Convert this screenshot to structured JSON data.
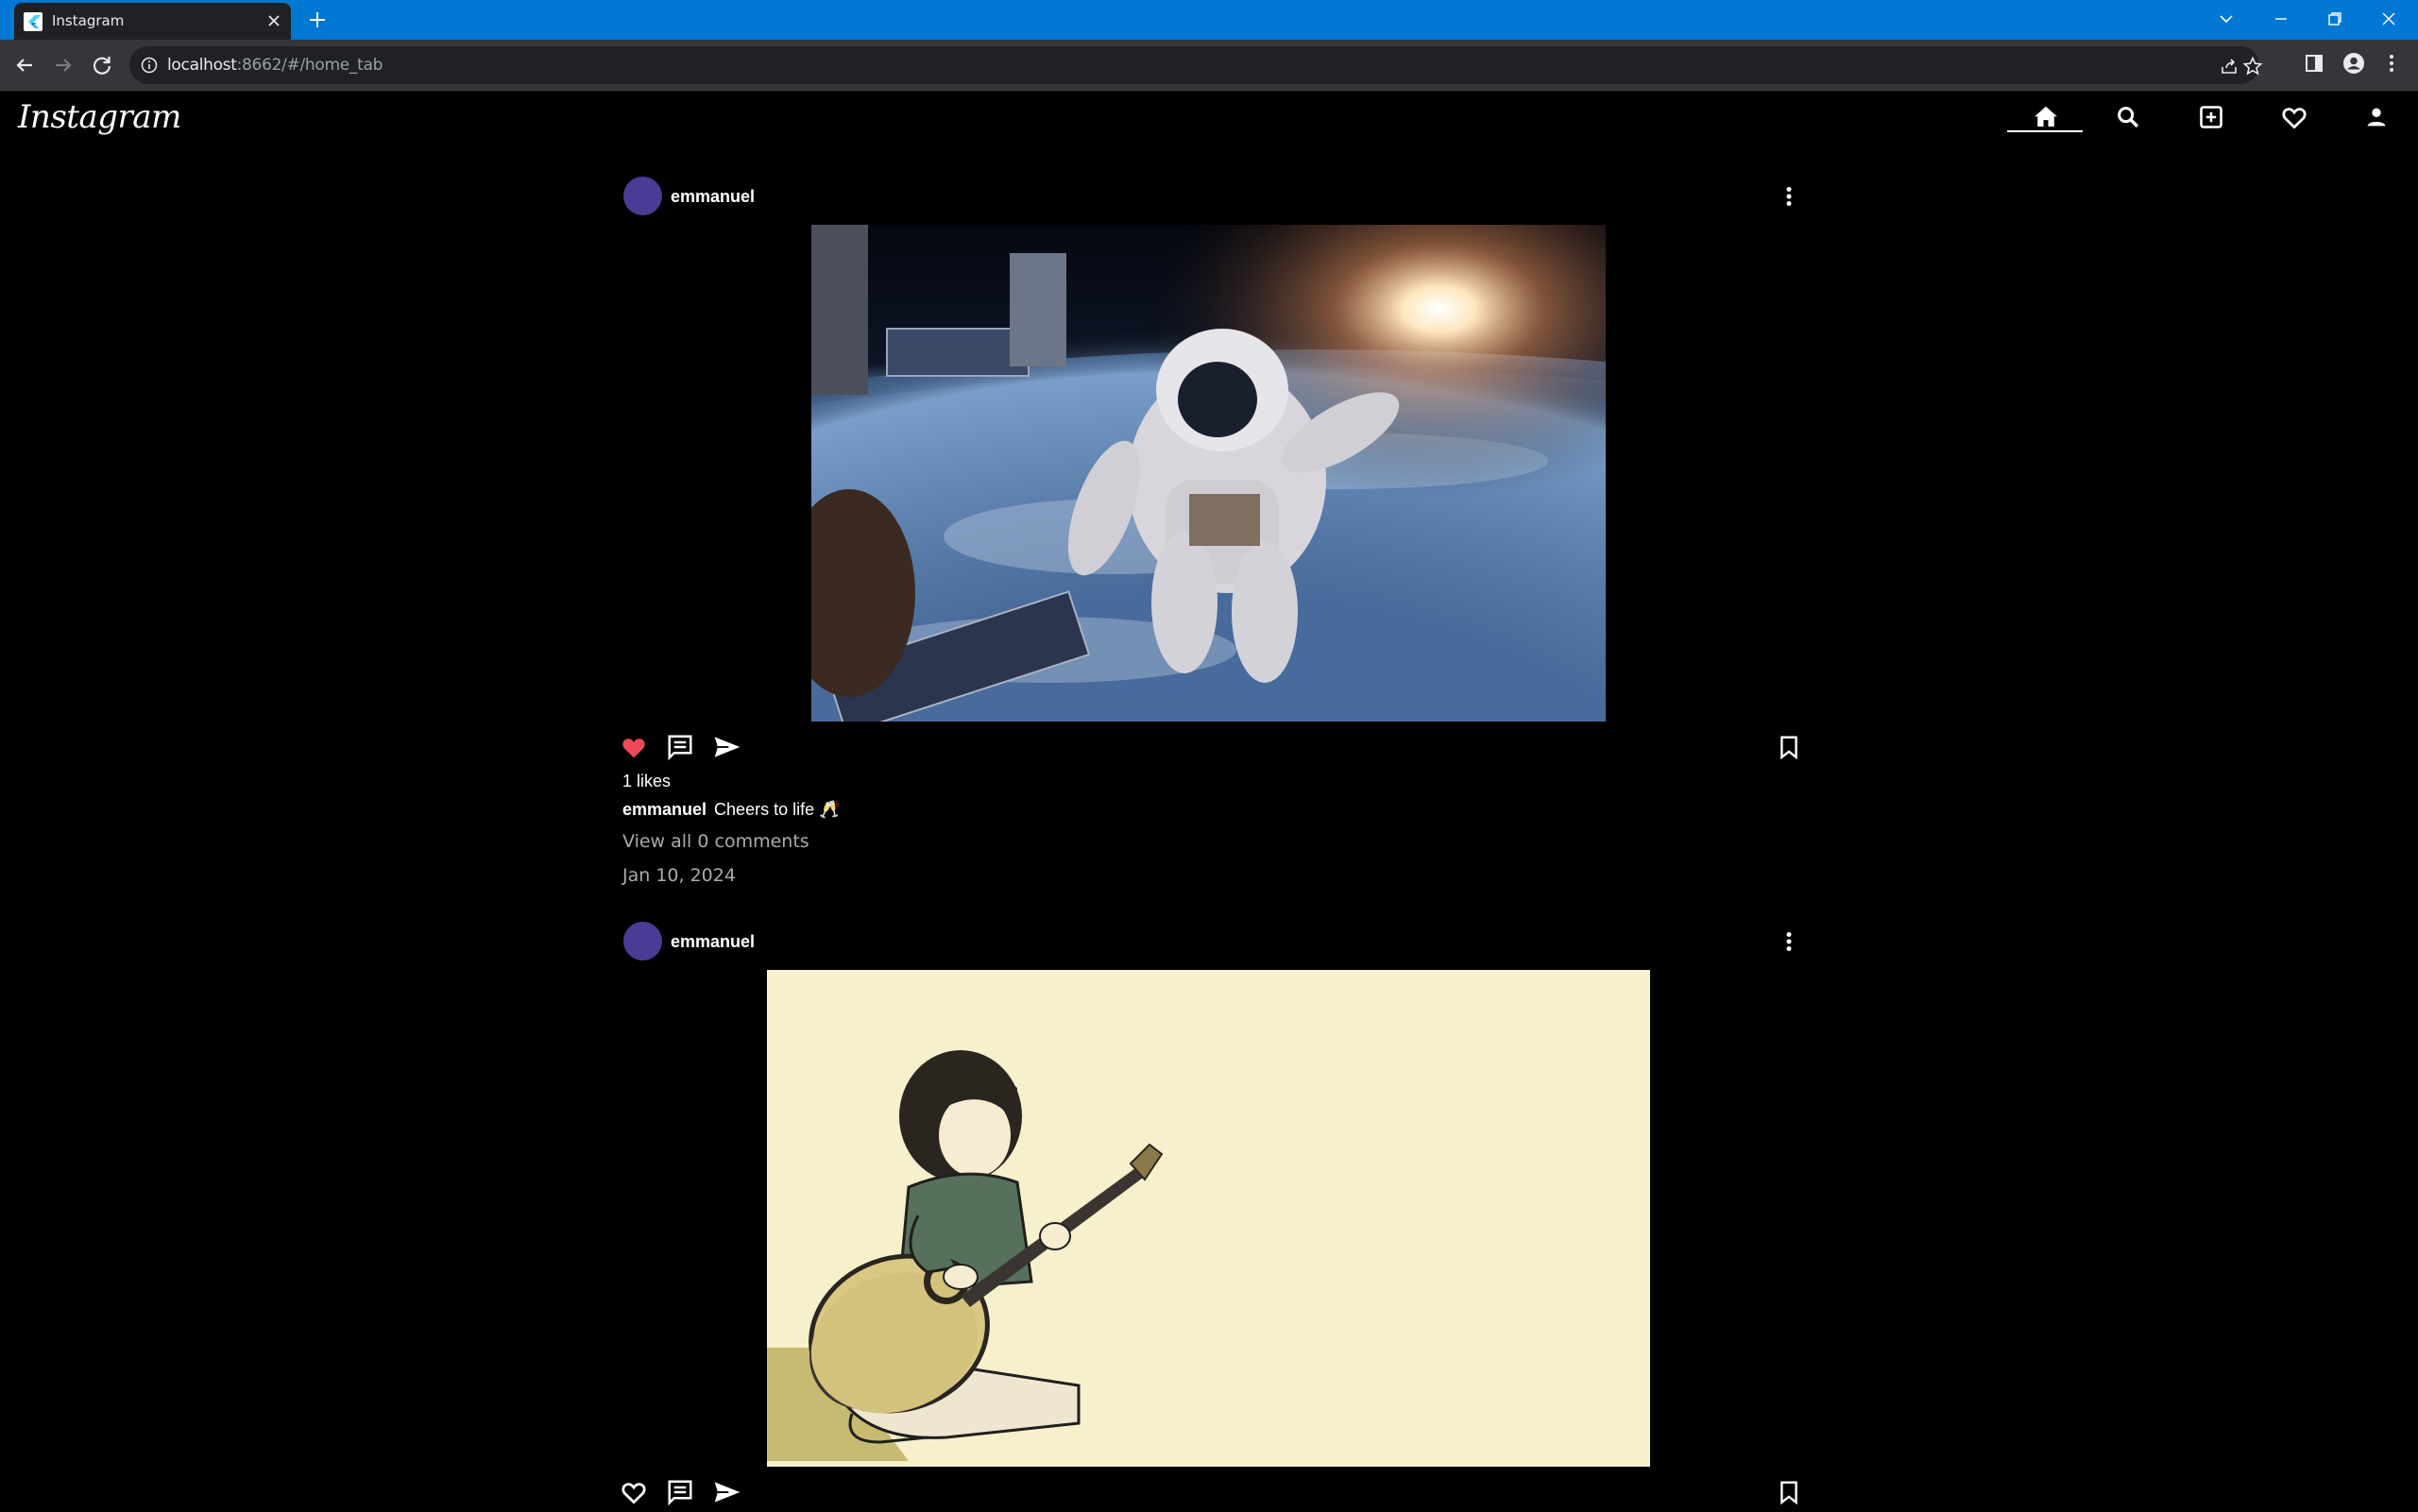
{
  "browser": {
    "tab_title": "Instagram",
    "url_host": "localhost",
    "url_path": ":8662/#/home_tab"
  },
  "app": {
    "logo": "Instagram",
    "nav": [
      "home-icon",
      "search-icon",
      "add-post-icon",
      "activity-heart-icon",
      "profile-icon"
    ],
    "active_nav": "home"
  },
  "posts": [
    {
      "username": "emmanuel",
      "image_description_icon": "astronaut-photo",
      "liked": true,
      "likes_text": "1 likes",
      "caption_user": "emmanuel",
      "caption_text": "Cheers to life 🥂",
      "view_comments": "View all 0 comments",
      "date": "Jan 10, 2024"
    },
    {
      "username": "emmanuel",
      "image_description_icon": "guitar-girl-illustration",
      "liked": false
    }
  ],
  "colors": {
    "titlebar": "#0078d4",
    "toolbar": "#35363a",
    "background": "#000000",
    "avatar": "#4c3b94",
    "like_red": "#ed4956"
  }
}
